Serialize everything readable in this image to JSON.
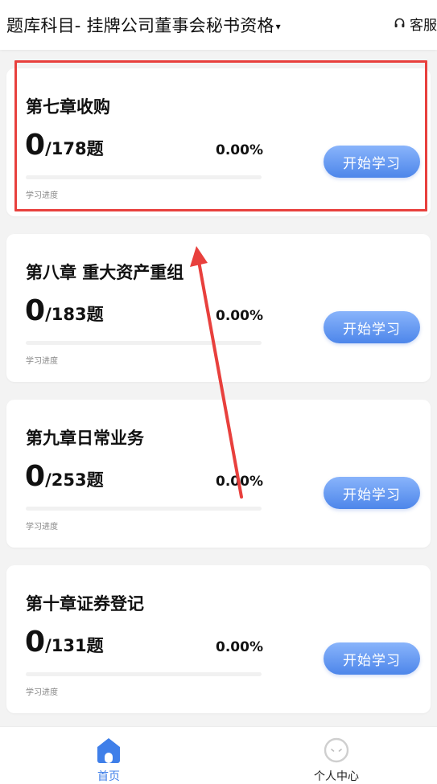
{
  "header": {
    "title": "题库科目- 挂牌公司董事会秘书资格",
    "caret": "▾",
    "service_icon": "headset-icon",
    "service_label": "客服"
  },
  "colors": {
    "accent": "#4f86ea",
    "button_gradient_top": "#89b4fb",
    "button_gradient_bottom": "#4d86ea",
    "annotation_red": "#e8403d",
    "page_background": "#f3f3f3"
  },
  "chapters": [
    {
      "title": "第七章收购",
      "done": "0",
      "total": "/178题",
      "progress": 0,
      "percent": "0.00%",
      "progress_label": "学习进度",
      "button": "开始学习"
    },
    {
      "title": "第八章 重大资产重组",
      "done": "0",
      "total": "/183题",
      "progress": 0,
      "percent": "0.00%",
      "progress_label": "学习进度",
      "button": "开始学习"
    },
    {
      "title": "第九章日常业务",
      "done": "0",
      "total": "/253题",
      "progress": 0,
      "percent": "0.00%",
      "progress_label": "学习进度",
      "button": "开始学习"
    },
    {
      "title": "第十章证券登记",
      "done": "0",
      "total": "/131题",
      "progress": 0,
      "percent": "0.00%",
      "progress_label": "学习进度",
      "button": "开始学习"
    }
  ],
  "annotation": {
    "highlighted_chapter_index": 0,
    "arrow": "pointing up to the highlighted chapter"
  },
  "tabbar": {
    "home": {
      "label": "首页",
      "icon": "home-icon",
      "active": true
    },
    "me": {
      "label": "个人中心",
      "icon": "user-face-icon",
      "active": false
    }
  }
}
